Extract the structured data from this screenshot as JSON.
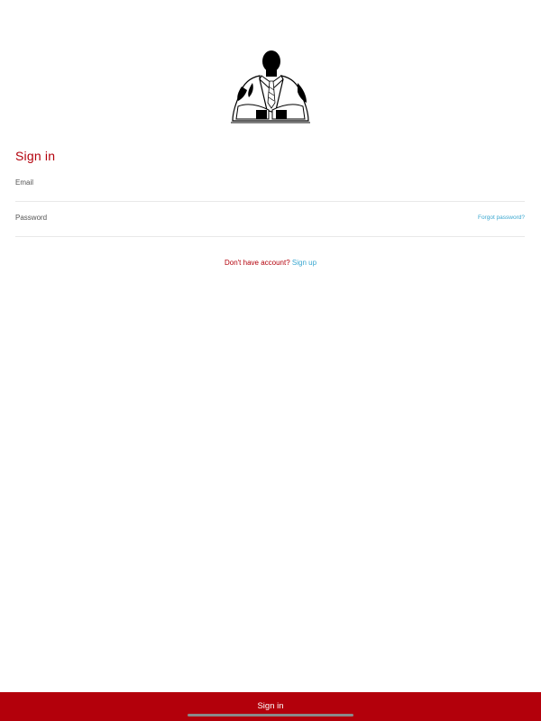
{
  "app": {
    "logo": "businessman-silhouette-logo",
    "accent_color": "#b3000b",
    "link_color": "#3aa7d0"
  },
  "form": {
    "title": "Sign in",
    "email": {
      "label": "Email",
      "value": "",
      "placeholder": ""
    },
    "password": {
      "label": "Password",
      "value": "",
      "placeholder": ""
    },
    "forgot_label": "Forgot password?",
    "signup_prompt": "Don't have account?",
    "signup_link": "Sign up"
  },
  "footer": {
    "submit_label": "Sign in"
  }
}
